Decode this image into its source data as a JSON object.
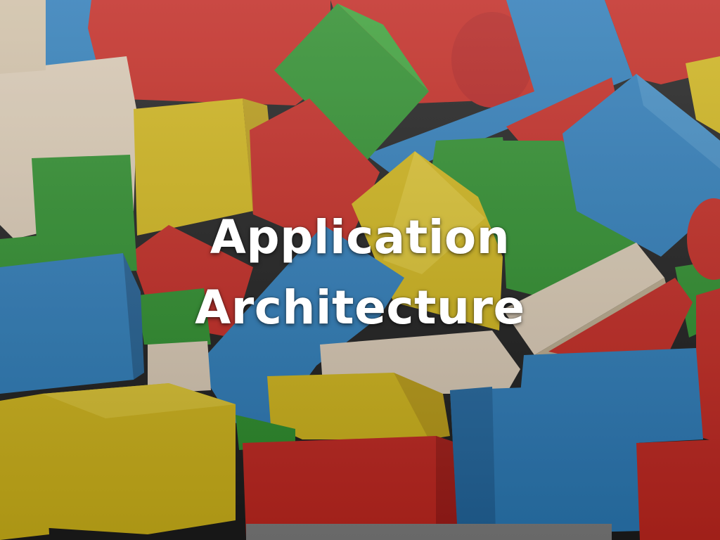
{
  "slide": {
    "title_line_1": "Application",
    "title_line_2": "Architecture"
  },
  "background": {
    "subject": "wooden-toy-blocks-photo",
    "colors": {
      "red": "#d42a22",
      "blue": "#2f86c9",
      "green": "#2f9a2e",
      "yellow": "#e3c51b",
      "natural-wood": "#eddcc4",
      "shadow": "#1e1e1e"
    }
  }
}
